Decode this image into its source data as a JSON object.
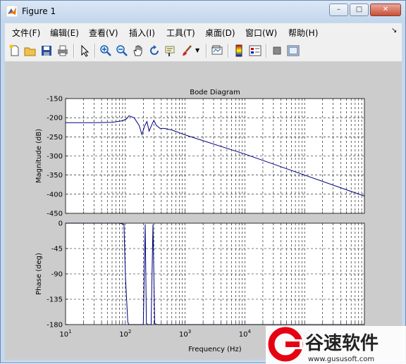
{
  "window": {
    "title": "Figure 1",
    "controls": {
      "minimize": "–",
      "maximize": "□",
      "close": "✕"
    }
  },
  "menu": [
    "文件(F)",
    "编辑(E)",
    "查看(V)",
    "插入(I)",
    "工具(T)",
    "桌面(D)",
    "窗口(W)",
    "帮助(H)"
  ],
  "menu_extra": "↘",
  "toolbar": {
    "icons": [
      "new-figure-icon",
      "open-file-icon",
      "save-icon",
      "print-icon",
      "edit-plot-arrow-icon",
      "zoom-in-icon",
      "zoom-out-icon",
      "pan-hand-icon",
      "rotate-3d-icon",
      "data-cursor-icon",
      "brush-icon",
      "link-plot-icon",
      "colorbar-icon",
      "legend-icon",
      "hide-plot-tools-icon",
      "show-plot-tools-icon"
    ]
  },
  "chart_data": [
    {
      "type": "line",
      "title": "Bode Diagram",
      "ylabel": "Magnitude (dB)",
      "xlabel": "",
      "x_scale": "log",
      "xlim": [
        10,
        1000000
      ],
      "ylim": [
        -450,
        -150
      ],
      "yticks": [
        -150,
        -200,
        -250,
        -300,
        -350,
        -400,
        -450
      ],
      "grid": true,
      "series": [
        {
          "color": "#000080",
          "x": [
            10,
            30,
            60,
            90,
            105,
            115,
            140,
            170,
            190,
            210,
            230,
            250,
            280,
            300,
            330,
            380,
            450,
            600,
            1000,
            10000,
            100000,
            1000000
          ],
          "y": [
            -213,
            -213,
            -212,
            -208,
            -203,
            -195,
            -200,
            -220,
            -244,
            -222,
            -210,
            -235,
            -217,
            -207,
            -220,
            -228,
            -228,
            -232,
            -245,
            -295,
            -350,
            -405
          ]
        }
      ]
    },
    {
      "type": "line",
      "title": "",
      "ylabel": "Phase (deg)",
      "xlabel": "Frequency  (Hz)",
      "x_scale": "log",
      "xlim": [
        10,
        1000000
      ],
      "ylim": [
        -180,
        0
      ],
      "yticks": [
        0,
        -45,
        -90,
        -135,
        -180
      ],
      "xticks": [
        10,
        100,
        1000,
        10000,
        100000
      ],
      "xtick_labels": [
        [
          "10",
          "1"
        ],
        [
          "10",
          "2"
        ],
        [
          "10",
          "3"
        ],
        [
          "10",
          "4"
        ],
        [
          "10",
          "5"
        ]
      ],
      "grid": true,
      "series": [
        {
          "color": "#000080",
          "x": [
            10,
            80,
            95,
            100,
            110,
            115,
            200,
            215,
            225,
            240,
            270,
            290,
            310,
            335,
            350,
            1000000
          ],
          "y": [
            0,
            0,
            -2,
            -90,
            -176,
            -180,
            -180,
            -2,
            -178,
            -180,
            -180,
            -2,
            -178,
            -180,
            -180,
            -180
          ]
        }
      ]
    }
  ],
  "watermark": {
    "brand": "谷速软件",
    "url": "www.gususoft.com",
    "colors": {
      "red": "#e60012",
      "dark": "#222222"
    }
  }
}
